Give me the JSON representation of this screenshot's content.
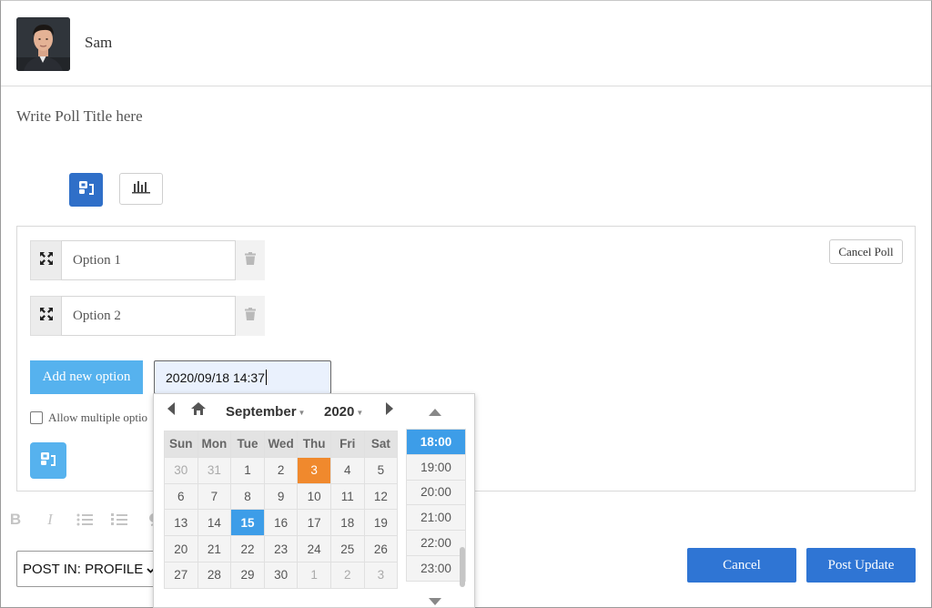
{
  "header": {
    "user_name": "Sam"
  },
  "poll": {
    "title_placeholder": "Write Poll Title here",
    "options": [
      {
        "value": "Option 1"
      },
      {
        "value": "Option 2"
      }
    ],
    "cancel_poll_label": "Cancel Poll",
    "add_option_label": "Add new option",
    "end_datetime": "2020/09/18 14:37",
    "allow_multiple_label": "Allow multiple optio"
  },
  "picker": {
    "month": "September",
    "year": "2020",
    "weekdays": [
      "Sun",
      "Mon",
      "Tue",
      "Wed",
      "Thu",
      "Fri",
      "Sat"
    ],
    "weeks": [
      [
        "30",
        "31",
        "1",
        "2",
        "3",
        "4",
        "5"
      ],
      [
        "6",
        "7",
        "8",
        "9",
        "10",
        "11",
        "12"
      ],
      [
        "13",
        "14",
        "15",
        "16",
        "17",
        "18",
        "19"
      ],
      [
        "20",
        "21",
        "22",
        "23",
        "24",
        "25",
        "26"
      ],
      [
        "27",
        "28",
        "29",
        "30",
        "1",
        "2",
        "3"
      ]
    ],
    "today": "3",
    "selected_day": "15",
    "times": [
      "18:00",
      "19:00",
      "20:00",
      "21:00",
      "22:00",
      "23:00"
    ],
    "selected_time": "18:00"
  },
  "footer": {
    "post_in": "POST IN: PROFILE",
    "cancel_label": "Cancel",
    "post_label": "Post Update"
  },
  "colors": {
    "primary_blue": "#2f75d4",
    "light_blue": "#56b2ee",
    "today_orange": "#f0892d",
    "selected_blue": "#3d9de8"
  }
}
